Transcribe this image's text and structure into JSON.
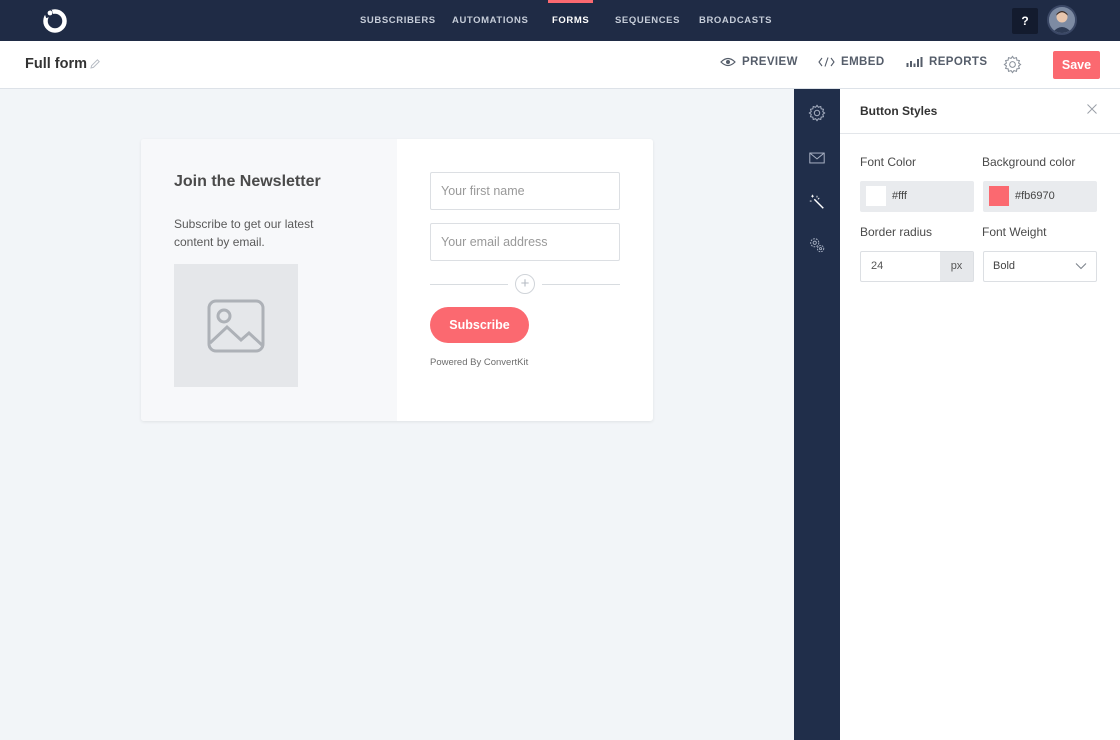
{
  "topnav": {
    "links": [
      {
        "label": "SUBSCRIBERS",
        "active": false
      },
      {
        "label": "AUTOMATIONS",
        "active": false
      },
      {
        "label": "FORMS",
        "active": true
      },
      {
        "label": "SEQUENCES",
        "active": false
      },
      {
        "label": "BROADCASTS",
        "active": false
      }
    ],
    "help_label": "?",
    "icons": {
      "logo": "convertkit-logo-icon",
      "avatar": "user-avatar"
    }
  },
  "subheader": {
    "title": "Full form",
    "actions": {
      "preview": "PREVIEW",
      "embed": "EMBED",
      "reports": "REPORTS"
    },
    "save_label": "Save",
    "icons": {
      "edit": "pencil-icon",
      "preview": "eye-icon",
      "embed": "code-icon",
      "reports": "bar-chart-icon",
      "settings": "gear-icon"
    }
  },
  "form_preview": {
    "heading": "Join the Newsletter",
    "description": "Subscribe to get our latest content by email.",
    "first_name_placeholder": "Your first name",
    "email_placeholder": "Your email address",
    "add_symbol": "+",
    "subscribe_label": "Subscribe",
    "powered_by": "Powered By ConvertKit",
    "icons": {
      "image": "image-placeholder-icon",
      "add": "plus-circle-icon"
    }
  },
  "rail": {
    "icons": [
      "settings-icon",
      "envelope-icon",
      "magic-wand-icon",
      "gears-icon"
    ]
  },
  "panel": {
    "title": "Button Styles",
    "font_color_label": "Font Color",
    "font_color_value": "#fff",
    "background_color_label": "Background color",
    "background_color_value": "#fb6970",
    "border_radius_label": "Border radius",
    "border_radius_value": "24",
    "border_radius_unit": "px",
    "font_weight_label": "Font Weight",
    "font_weight_value": "Bold",
    "icons": {
      "close": "close-icon",
      "dropdown": "chevron-down-icon"
    }
  },
  "colors": {
    "nav_bg": "#1f2b45",
    "rail_bg": "#202e4a",
    "accent": "#fb6970",
    "canvas_bg": "#f2f5f8"
  }
}
